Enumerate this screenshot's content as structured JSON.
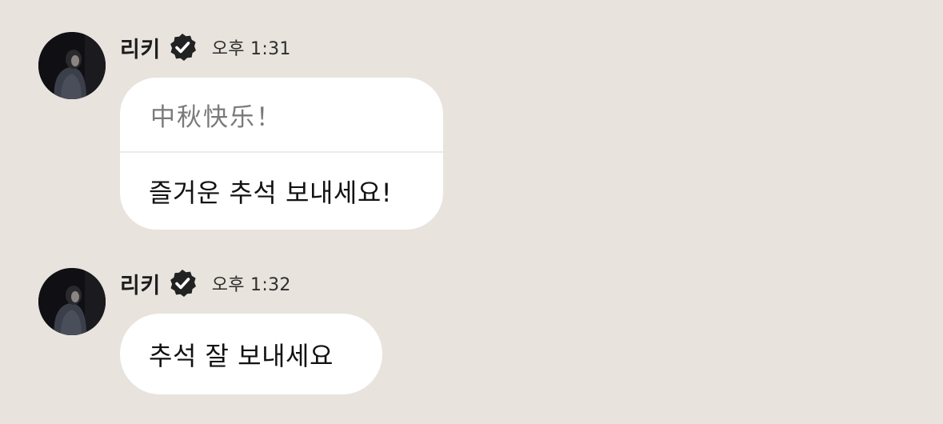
{
  "messages": [
    {
      "sender": "리키",
      "time": "오후 1:31",
      "translation": "中秋快乐！",
      "text": "즐거운 추석 보내세요!"
    },
    {
      "sender": "리키",
      "time": "오후 1:32",
      "text": "추석 잘 보내세요"
    }
  ],
  "icons": {
    "avatar": "profile-photo",
    "verified": "verified-badge-icon"
  },
  "colors": {
    "background": "#e8e3dd",
    "bubble": "#ffffff",
    "translation_text": "#7a7a7a",
    "message_text": "#121212",
    "badge": "#222222"
  }
}
